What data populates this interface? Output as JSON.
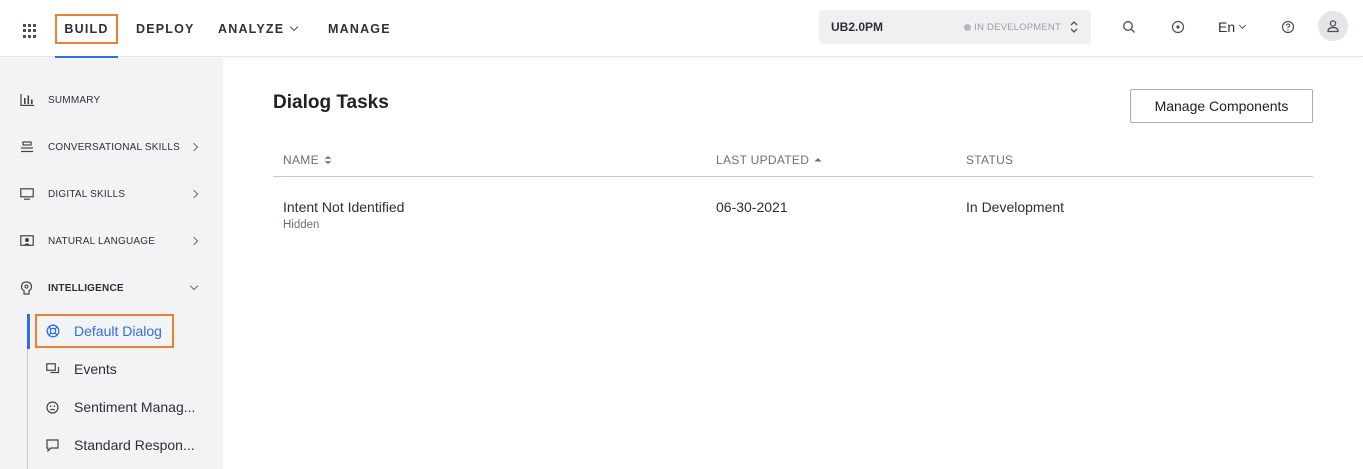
{
  "header": {
    "nav": [
      {
        "label": "BUILD",
        "active": true
      },
      {
        "label": "DEPLOY"
      },
      {
        "label": "ANALYZE"
      },
      {
        "label": "MANAGE"
      }
    ],
    "bot": {
      "name": "UB2.0PM",
      "status": "IN DEVELOPMENT"
    },
    "language": "En",
    "icons": [
      "apps-grid-icon",
      "search-icon",
      "notification-icon",
      "help-icon",
      "user-avatar-icon"
    ]
  },
  "sidebar": {
    "items": [
      {
        "label": "SUMMARY",
        "icon": "bar-chart-icon"
      },
      {
        "label": "CONVERSATIONAL SKILLS",
        "icon": "stack-icon"
      },
      {
        "label": "DIGITAL SKILLS",
        "icon": "monitor-icon"
      },
      {
        "label": "NATURAL LANGUAGE",
        "icon": "nlp-icon"
      },
      {
        "label": "INTELLIGENCE",
        "icon": "brain-icon",
        "expanded": true
      }
    ],
    "sub_items": [
      {
        "label": "Default Dialog",
        "icon": "lifebuoy-icon",
        "active": true
      },
      {
        "label": "Events",
        "icon": "chat-bubbles-icon"
      },
      {
        "label": "Sentiment Manag...",
        "icon": "smiley-icon"
      },
      {
        "label": "Standard Respon...",
        "icon": "message-icon"
      }
    ]
  },
  "main": {
    "title": "Dialog Tasks",
    "manage_button": "Manage Components",
    "columns": [
      "NAME",
      "LAST UPDATED",
      "STATUS"
    ],
    "rows": [
      {
        "name": "Intent Not Identified",
        "sub": "Hidden",
        "updated": "06-30-2021",
        "status": "In Development"
      }
    ]
  },
  "colors": {
    "accent": "#2f6fe0",
    "highlight": "#ee7f30",
    "sidebar_bg": "#f2f3f5"
  }
}
